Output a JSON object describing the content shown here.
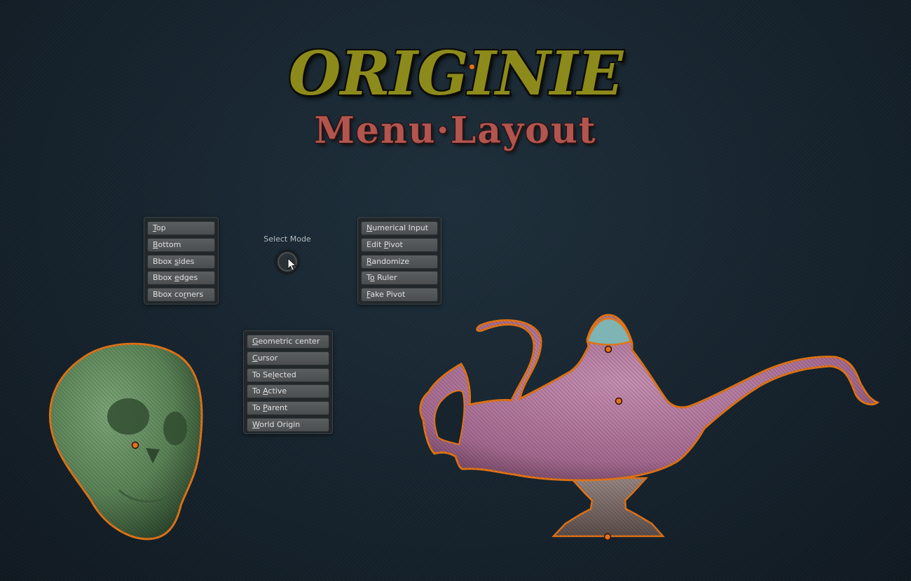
{
  "title": {
    "main": "ORIGINIE",
    "sub": "Menu·Layout"
  },
  "menus": {
    "bounds": [
      {
        "prefix": "",
        "key": "T",
        "rest": "op"
      },
      {
        "prefix": "",
        "key": "B",
        "rest": "ottom"
      },
      {
        "prefix": "Bbox ",
        "key": "s",
        "rest": "ides"
      },
      {
        "prefix": "Bbox ",
        "key": "e",
        "rest": "dges"
      },
      {
        "prefix": "Bbox co",
        "key": "r",
        "rest": "ners"
      }
    ],
    "tools": [
      {
        "prefix": "",
        "key": "N",
        "rest": "umerical Input"
      },
      {
        "prefix": "Edit ",
        "key": "P",
        "rest": "ivot"
      },
      {
        "prefix": "",
        "key": "R",
        "rest": "andomize"
      },
      {
        "prefix": "T",
        "key": "o",
        "rest": " Ruler"
      },
      {
        "prefix": "",
        "key": "F",
        "rest": "ake Pivot"
      }
    ],
    "origin": [
      {
        "prefix": "",
        "key": "G",
        "rest": "eometric center"
      },
      {
        "prefix": "",
        "key": "C",
        "rest": "ursor"
      },
      {
        "prefix": "To Se",
        "key": "l",
        "rest": "ected"
      },
      {
        "prefix": "To ",
        "key": "A",
        "rest": "ctive"
      },
      {
        "prefix": "To ",
        "key": "P",
        "rest": "arent"
      },
      {
        "prefix": "",
        "key": "W",
        "rest": "orld Origin"
      }
    ]
  },
  "select_mode": {
    "label": "Select Mode"
  },
  "icons": {
    "cursor": "mouse-pointer-icon",
    "select": "radial-select-icon"
  },
  "colors": {
    "title_main": "#8d8a1c",
    "title_sub": "#b2554f",
    "selection_outline": "#e07418",
    "skull": "#5f8a5c",
    "lamp_body": "#b77aa2",
    "lamp_cap": "#7fb4b4",
    "lamp_base": "#7d6e6a"
  }
}
